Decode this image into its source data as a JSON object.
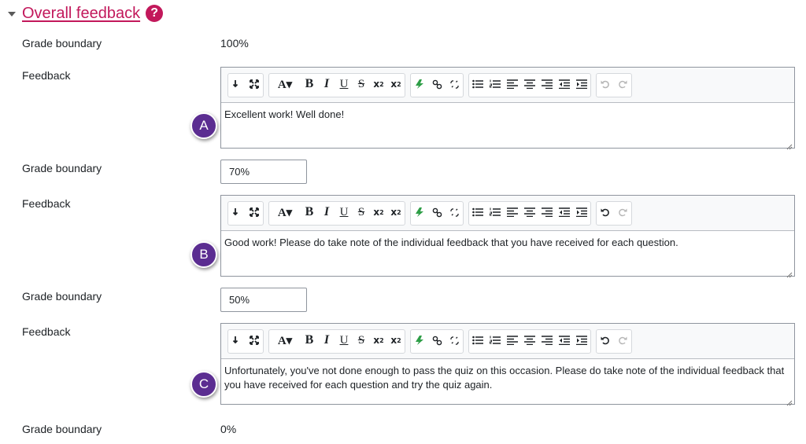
{
  "section": {
    "title": "Overall feedback",
    "help_icon": "?"
  },
  "labels": {
    "grade_boundary": "Grade boundary",
    "feedback": "Feedback"
  },
  "toolbar": {
    "font_label": "A▾",
    "bold": "B",
    "italic": "I",
    "underline": "U",
    "strike": "S",
    "subscript": "x",
    "subscript_mark": "2",
    "superscript": "x",
    "superscript_mark": "2"
  },
  "boundaries": [
    {
      "value": "100%"
    },
    {
      "value": "70%"
    },
    {
      "value": "50%"
    },
    {
      "value": "0%"
    }
  ],
  "feedbacks": [
    {
      "marker": "A",
      "text": "Excellent work! Well done!",
      "undo_enabled": false
    },
    {
      "marker": "B",
      "text": "Good work! Please do take note of the individual feedback that you have received for each question.",
      "undo_enabled": true
    },
    {
      "marker": "C",
      "text": "Unfortunately, you've not done enough to pass the quiz on this occasion. Please do take note of the individual feedback that you have received for each question and try the quiz again.",
      "undo_enabled": true
    }
  ],
  "colors": {
    "accent": "#c2185b",
    "marker": "#5b2d91",
    "border": "#8f959e",
    "toolbar_bg": "#f8f9fa"
  }
}
